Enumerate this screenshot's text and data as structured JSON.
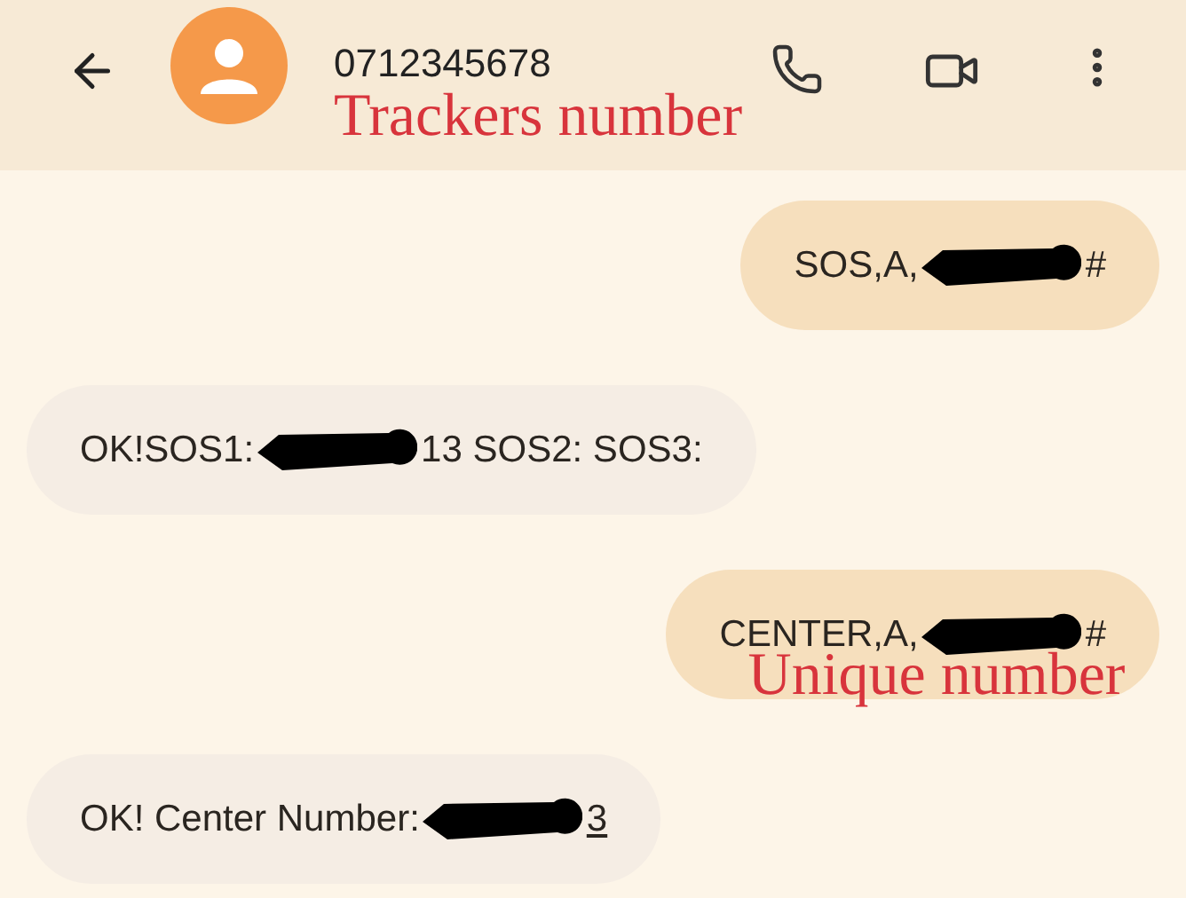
{
  "header": {
    "contact": "0712345678"
  },
  "annotations": [
    {
      "kind": "header",
      "text": "Trackers number"
    }
  ],
  "messages": [
    {
      "kind": "sent",
      "before": "SOS,A,",
      "after": "#",
      "underline_after": false
    },
    {
      "kind": "received",
      "before": "OK!SOS1:",
      "after": "13 SOS2: SOS3:",
      "underline_after": false
    },
    {
      "kind": "sent",
      "before": "CENTER,A,",
      "after": "#",
      "underline_after": false,
      "note": "Unique number"
    },
    {
      "kind": "received",
      "before": "OK! Center Number:",
      "after": "3",
      "underline_after": true
    }
  ]
}
